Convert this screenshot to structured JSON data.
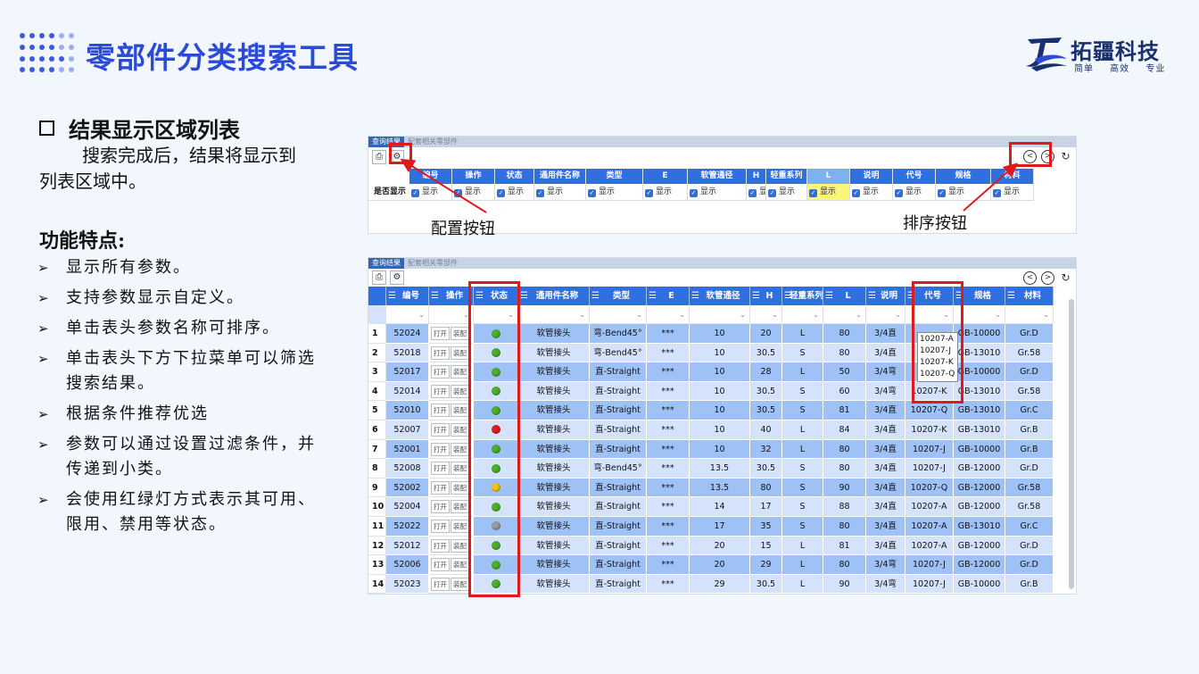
{
  "header": {
    "title": "零部件分类搜索工具",
    "logo_name": "拓疆科技",
    "logo_slogan": "简单 高效 专业"
  },
  "section": {
    "title": "结果显示区域列表",
    "intro": "搜索完成后，结果将显示到列表区域中。"
  },
  "features": {
    "title": "功能特点:",
    "items": [
      "显示所有参数。",
      "支持参数显示自定义。",
      "单击表头参数名称可排序。",
      "单击表头下方下拉菜单可以筛选搜索结果。",
      "根据条件推荐优选",
      "参数可以通过设置过滤条件，并传递到小类。",
      "会使用红绿灯方式表示其可用、限用、禁用等状态。"
    ]
  },
  "tabs": [
    "查询结果",
    "配套相关零部件"
  ],
  "config": {
    "row_label": "是否显示",
    "checkbox_label": "显示",
    "columns": [
      "编号",
      "操作",
      "状态",
      "通用件名称",
      "类型",
      "E",
      "软管通径",
      "H",
      "轻重系列",
      "L",
      "说明",
      "代号",
      "规格",
      "材料"
    ]
  },
  "annotations": {
    "config_button": "配置按钮",
    "sort_button": "排序按钮"
  },
  "table": {
    "columns": [
      "编号",
      "操作",
      "状态",
      "通用件名称",
      "类型",
      "E",
      "软管通径",
      "H",
      "轻重系列",
      "L",
      "说明",
      "代号",
      "规格",
      "材料"
    ],
    "op_open": "打开",
    "op_assemble": "装配",
    "dropdown_options": [
      "10207-A",
      "10207-J",
      "10207-K",
      "10207-Q"
    ],
    "rows": [
      {
        "idx": "1",
        "id": "52024",
        "status": "green",
        "name": "软管接头",
        "type": "弯-Bend45°",
        "e": "***",
        "dn": "10",
        "h": "20",
        "series": "L",
        "l": "80",
        "desc": "3/4直",
        "code": "",
        "spec": "GB-10000",
        "mat": "Gr.D"
      },
      {
        "idx": "2",
        "id": "52018",
        "status": "green",
        "name": "软管接头",
        "type": "弯-Bend45°",
        "e": "***",
        "dn": "10",
        "h": "30.5",
        "series": "S",
        "l": "80",
        "desc": "3/4直",
        "code": "",
        "spec": "GB-13010",
        "mat": "Gr.58"
      },
      {
        "idx": "3",
        "id": "52017",
        "status": "green",
        "name": "软管接头",
        "type": "直-Straight",
        "e": "***",
        "dn": "10",
        "h": "28",
        "series": "L",
        "l": "50",
        "desc": "3/4弯",
        "code": "",
        "spec": "GB-10000",
        "mat": "Gr.D"
      },
      {
        "idx": "4",
        "id": "52014",
        "status": "green",
        "name": "软管接头",
        "type": "直-Straight",
        "e": "***",
        "dn": "10",
        "h": "30.5",
        "series": "S",
        "l": "60",
        "desc": "3/4弯",
        "code": "10207-K",
        "spec": "GB-13010",
        "mat": "Gr.58"
      },
      {
        "idx": "5",
        "id": "52010",
        "status": "green",
        "name": "软管接头",
        "type": "直-Straight",
        "e": "***",
        "dn": "10",
        "h": "30.5",
        "series": "S",
        "l": "81",
        "desc": "3/4直",
        "code": "10207-Q",
        "spec": "GB-13010",
        "mat": "Gr.C"
      },
      {
        "idx": "6",
        "id": "52007",
        "status": "red",
        "name": "软管接头",
        "type": "直-Straight",
        "e": "***",
        "dn": "10",
        "h": "40",
        "series": "L",
        "l": "84",
        "desc": "3/4直",
        "code": "10207-K",
        "spec": "GB-13010",
        "mat": "Gr.B"
      },
      {
        "idx": "7",
        "id": "52001",
        "status": "green",
        "name": "软管接头",
        "type": "直-Straight",
        "e": "***",
        "dn": "10",
        "h": "32",
        "series": "L",
        "l": "80",
        "desc": "3/4直",
        "code": "10207-J",
        "spec": "GB-10000",
        "mat": "Gr.B"
      },
      {
        "idx": "8",
        "id": "52008",
        "status": "green",
        "name": "软管接头",
        "type": "弯-Bend45°",
        "e": "***",
        "dn": "13.5",
        "h": "30.5",
        "series": "S",
        "l": "80",
        "desc": "3/4直",
        "code": "10207-J",
        "spec": "GB-12000",
        "mat": "Gr.D"
      },
      {
        "idx": "9",
        "id": "52002",
        "status": "yellow",
        "name": "软管接头",
        "type": "直-Straight",
        "e": "***",
        "dn": "13.5",
        "h": "80",
        "series": "S",
        "l": "90",
        "desc": "3/4直",
        "code": "10207-Q",
        "spec": "GB-12000",
        "mat": "Gr.58"
      },
      {
        "idx": "10",
        "id": "52004",
        "status": "green",
        "name": "软管接头",
        "type": "直-Straight",
        "e": "***",
        "dn": "14",
        "h": "17",
        "series": "S",
        "l": "88",
        "desc": "3/4直",
        "code": "10207-A",
        "spec": "GB-12000",
        "mat": "Gr.58"
      },
      {
        "idx": "11",
        "id": "52022",
        "status": "gray",
        "name": "软管接头",
        "type": "直-Straight",
        "e": "***",
        "dn": "17",
        "h": "35",
        "series": "S",
        "l": "80",
        "desc": "3/4直",
        "code": "10207-A",
        "spec": "GB-13010",
        "mat": "Gr.C"
      },
      {
        "idx": "12",
        "id": "52012",
        "status": "green",
        "name": "软管接头",
        "type": "直-Straight",
        "e": "***",
        "dn": "20",
        "h": "15",
        "series": "L",
        "l": "81",
        "desc": "3/4直",
        "code": "10207-A",
        "spec": "GB-12000",
        "mat": "Gr.D"
      },
      {
        "idx": "13",
        "id": "52006",
        "status": "green",
        "name": "软管接头",
        "type": "直-Straight",
        "e": "***",
        "dn": "20",
        "h": "29",
        "series": "L",
        "l": "80",
        "desc": "3/4弯",
        "code": "10207-J",
        "spec": "GB-12000",
        "mat": "Gr.D"
      },
      {
        "idx": "14",
        "id": "52023",
        "status": "green",
        "name": "软管接头",
        "type": "直-Straight",
        "e": "***",
        "dn": "29",
        "h": "30.5",
        "series": "L",
        "l": "90",
        "desc": "3/4弯",
        "code": "10207-J",
        "spec": "GB-10000",
        "mat": "Gr.B"
      }
    ]
  },
  "colors": {
    "accent": "#2b4ad6",
    "header_blue": "#2f6fe0",
    "row_dark": "#9fc2f6",
    "row_light": "#d4e3fb",
    "highlight": "#e01a1a",
    "status_green": "#4caf2a",
    "status_red": "#e11b1b",
    "status_yellow": "#f0c419",
    "status_gray": "#9a9a9a"
  },
  "icons": {
    "config": "gear-document-icon",
    "prev": "chevron-left-circle-icon",
    "next": "chevron-right-circle-icon",
    "refresh": "refresh-icon",
    "print": "print-preview-icon",
    "sort": "sort-icon",
    "filter": "chevron-down-icon"
  }
}
